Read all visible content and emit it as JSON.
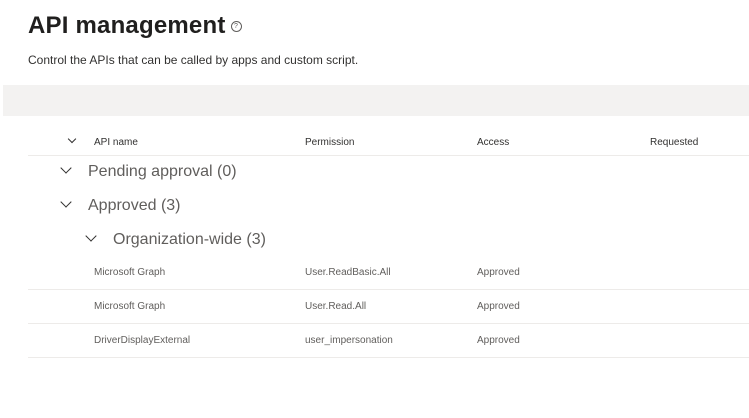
{
  "header": {
    "title": "API management",
    "help_icon": "?",
    "subtitle": "Control the APIs that can be called by apps and custom script."
  },
  "table": {
    "columns": [
      "API name",
      "Permission",
      "Access",
      "Requested"
    ],
    "groups": [
      {
        "label": "Pending approval (0)"
      },
      {
        "label": "Approved (3)"
      },
      {
        "label": "Organization-wide (3)"
      }
    ],
    "rows": [
      {
        "api": "Microsoft Graph",
        "permission": "User.ReadBasic.All",
        "access": "Approved",
        "requested": ""
      },
      {
        "api": "Microsoft Graph",
        "permission": "User.Read.All",
        "access": "Approved",
        "requested": ""
      },
      {
        "api": "DriverDisplayExternal",
        "permission": "user_impersonation",
        "access": "Approved",
        "requested": ""
      }
    ]
  }
}
